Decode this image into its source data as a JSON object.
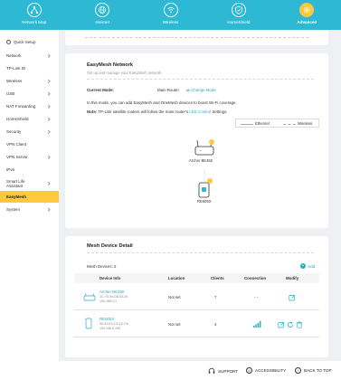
{
  "nav": {
    "items": [
      {
        "label": "Network Map",
        "icon": "network-map-icon"
      },
      {
        "label": "Internet",
        "icon": "globe-icon"
      },
      {
        "label": "Wireless",
        "icon": "wifi-icon"
      },
      {
        "label": "HomeShield",
        "icon": "shield-icon"
      },
      {
        "label": "Advanced",
        "icon": "gear-icon",
        "active": true
      }
    ]
  },
  "sidebar": {
    "items": [
      {
        "label": "Quick Setup"
      },
      {
        "label": "Network"
      },
      {
        "label": "TP-Link ID"
      },
      {
        "label": "Wireless"
      },
      {
        "label": "USB"
      },
      {
        "label": "NAT Forwarding"
      },
      {
        "label": "HomeShield"
      },
      {
        "label": "Security"
      },
      {
        "label": "VPN Client"
      },
      {
        "label": "VPN Server"
      },
      {
        "label": "IPv6"
      },
      {
        "label": "Smart Life Assistant"
      },
      {
        "label": "EasyMesh",
        "active": true
      },
      {
        "label": "System"
      }
    ]
  },
  "easymesh": {
    "title": "EasyMesh Network",
    "subtitle": "Set up and manage your EasyMesh network.",
    "current_mode_label": "Current Mode:",
    "current_mode_value": "Main Router",
    "change_mode_label": "Change Mode",
    "info_text": "In this mode, you can add EasyMesh and OneMesh devices to boost Wi-Fi coverage.",
    "note_label": "Note:",
    "note_text_before": "TP-Link satellite routers will follow the main router's",
    "note_link": "LED Control",
    "note_text_after": "Settings.",
    "legend_ethernet": "Ethernet",
    "legend_wireless": "Wireless",
    "topology": {
      "main_router": "Archer BE450",
      "satellite": "RE605X"
    }
  },
  "detail": {
    "title": "Mesh Device Detail",
    "devices_count_label": "Mesh Devices: 2",
    "add_label": "Add",
    "columns": [
      "Device Info",
      "Location",
      "Clients",
      "Connection",
      "Modify"
    ],
    "rows": [
      {
        "name": "Archer BE450",
        "mac": "3C-78-95-D8-53-26",
        "ip": "192.168.0.1",
        "location": "Not set",
        "clients": "7",
        "connection": "- -"
      },
      {
        "name": "RE605X",
        "mac": "50-91-E3-C5-1C-F8",
        "ip": "192.168.0.199",
        "location": "Not set",
        "clients": "4",
        "connection": "signal"
      }
    ]
  },
  "footer": {
    "support": "SUPPORT",
    "accessibility": "ACCESSIBILITY",
    "back_to_top": "BACK TO TOP"
  },
  "colors": {
    "nav_bg": "#2db9d4",
    "accent": "#ffc83d",
    "link": "#2aa7c9"
  }
}
